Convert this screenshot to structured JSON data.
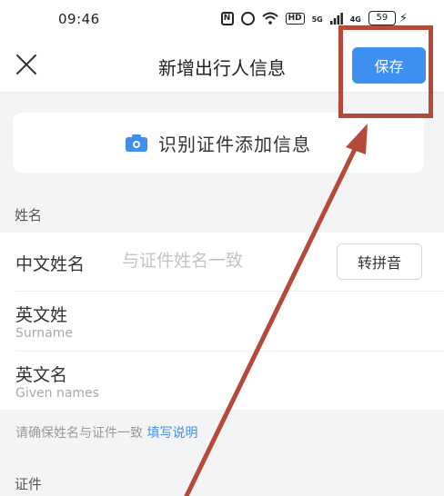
{
  "status_bar": {
    "time": "09:46",
    "nfc_label": "N",
    "hd_label": "HD",
    "net_label_1": "5G",
    "net_label_2": "4G",
    "battery": "59"
  },
  "nav": {
    "close_icon": "close-icon",
    "title": "新增出行人信息",
    "save_label": "保存"
  },
  "scan": {
    "icon": "camera-icon",
    "label": "识别证件添加信息"
  },
  "name_section": {
    "label": "姓名",
    "chinese_name": {
      "label": "中文姓名",
      "placeholder": "与证件姓名一致",
      "pinyin_button": "转拼音"
    },
    "surname": {
      "label": "英文姓",
      "sub_label": "Surname"
    },
    "given_names": {
      "label": "英文名",
      "sub_label": "Given names"
    }
  },
  "hint": {
    "text": "请确保姓名与证件一致",
    "link": "填写说明"
  },
  "certificate_section": {
    "label": "证件"
  },
  "colors": {
    "accent": "#3d8ff0",
    "annotation": "#b54a3a",
    "background": "#f3f4f6"
  }
}
